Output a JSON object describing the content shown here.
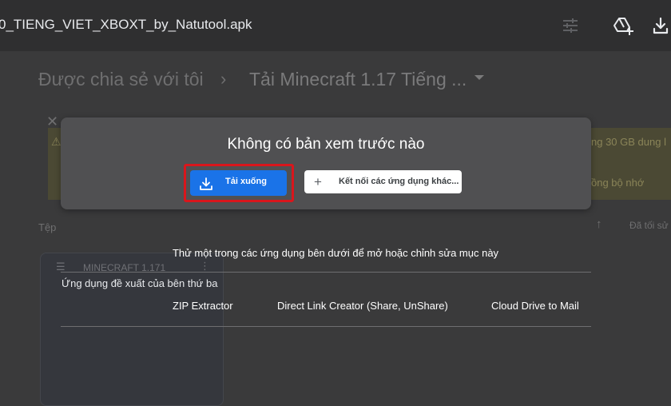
{
  "topbar": {
    "file_title": "0_TIENG_VIET_XBOXT_by_Natutool.apk",
    "icons": [
      "tune-icon",
      "add-to-drive-icon",
      "download-icon"
    ]
  },
  "background": {
    "breadcrumb_root": "Được chia sẻ với tôi",
    "breadcrumb_sep": "›",
    "breadcrumb_folder": "Tải Minecraft 1.17 Tiếng ...",
    "close_glyph": "✕",
    "warn_glyph": "⚠",
    "banner_text_1": "ng 30 GB dung l",
    "banner_text_2": "ồng bộ nhớ",
    "files_label": "Tệp",
    "sort_arrow": "↑",
    "sort_label": "Đã tối sử",
    "card_title": "MINECRAFT 1.171",
    "card_icon": "☰",
    "card_menu": "⋮"
  },
  "dialog": {
    "title": "Không có bản xem trước nào",
    "download_label": "Tải xuống",
    "connect_label": "Kết nối các ứng dụng khác...",
    "plus_glyph": "+",
    "highlight_color": "#d9161c",
    "accent_color": "#1a73e8"
  },
  "apps": {
    "try_text": "Thử một trong các ứng dụng bên dưới để mở hoặc chỉnh sửa mục này",
    "third_party_label": "Ứng dụng đề xuất của bên thứ ba",
    "items": [
      "ZIP Extractor",
      "Direct Link Creator (Share, UnShare)",
      "Cloud Drive to Mail"
    ]
  }
}
